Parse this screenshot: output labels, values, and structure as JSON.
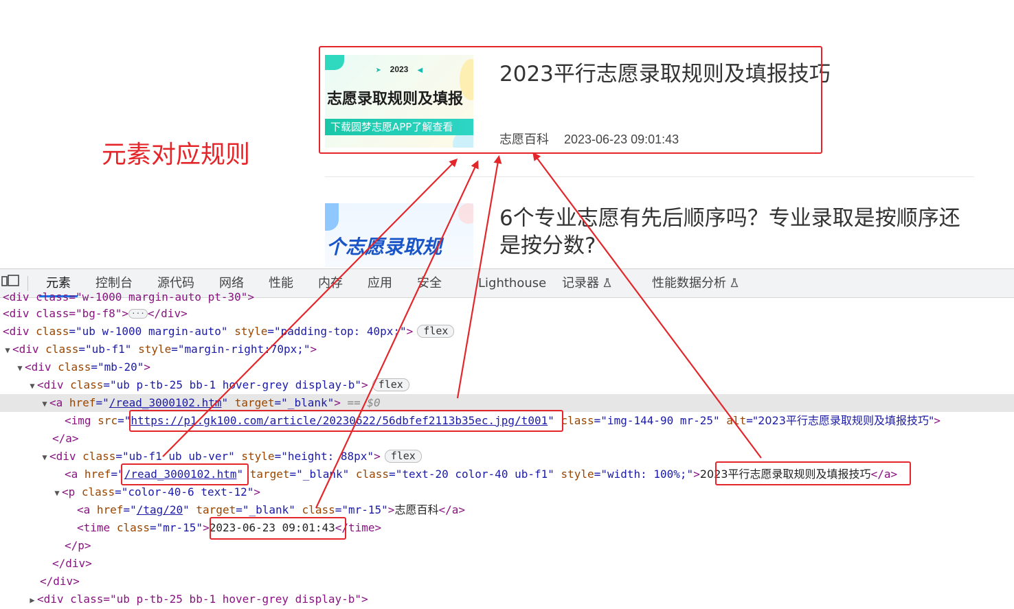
{
  "annotation": {
    "title": "元素对应规则"
  },
  "articles": [
    {
      "thumb_year": "2023",
      "thumb_title": "志愿录取规则及填报",
      "thumb_banner": "下载圆梦志愿APP了解查看",
      "title": "2023平行志愿录取规则及填报技巧",
      "tag": "志愿百科",
      "time": "2023-06-23 09:01:43"
    },
    {
      "thumb_title": "个志愿录取规",
      "title": "6个专业志愿有先后顺序吗？专业录取是按顺序还是按分数?"
    }
  ],
  "devtools": {
    "tabs": [
      "元素",
      "控制台",
      "源代码",
      "网络",
      "性能",
      "内存",
      "应用",
      "安全",
      "Lighthouse",
      "记录器",
      "性能数据分析"
    ],
    "lines": {
      "l0": "<div class=\"w-1000 margin-auto pt-30\">",
      "l1_open": "<div class=\"bg-f8\">",
      "l1_close": "</div>",
      "l2_tag": "<div",
      "l2_attr1": "class",
      "l2_val1": "\"ub w-1000 margin-auto\"",
      "l2_attr2": "style",
      "l2_val2": "\"padding-top: 40px;\"",
      "l2_end": ">",
      "flex": "flex",
      "l3_tag": "<div",
      "l3_attr1": "class",
      "l3_val1": "\"ub-f1\"",
      "l3_attr2": "style",
      "l3_val2": "\"margin-right:70px;\"",
      "l3_end": ">",
      "l4_tag": "<div",
      "l4_attr1": "class",
      "l4_val1": "\"mb-20\"",
      "l4_end": ">",
      "l5_tag": "<div",
      "l5_attr1": "class",
      "l5_val1": "\"ub p-tb-25 bb-1 hover-grey display-b\"",
      "l5_end": ">",
      "l6_tag": "<a",
      "l6_attr1": "href",
      "l6_link": "/read_3000102.htm",
      "l6_attr2": "target",
      "l6_val2": "\"_blank\"",
      "l6_end": ">",
      "l6_sel": "== $0",
      "l7_tag": "<img",
      "l7_attr1": "src",
      "l7_link": "https://p1.gk100.com/article/20230622/56dbfef2113b35ec.jpg/t001",
      "l7_attr2": "class",
      "l7_val2": "\"img-144-90 mr-25\"",
      "l7_attr3": "alt",
      "l7_val3": "\"2023平行志愿录取规则及填报技巧\"",
      "l7_end": ">",
      "l8": "</a>",
      "l9_tag": "<div",
      "l9_attr1": "class",
      "l9_val1": "\"ub-f1 ub ub-ver\"",
      "l9_attr2": "style",
      "l9_val2": "\"height: 88px\"",
      "l9_end": ">",
      "l10_tag": "<a",
      "l10_attr1": "href",
      "l10_link": "/read_3000102.htm",
      "l10_attr2": "target",
      "l10_val2": "\"_blank\"",
      "l10_attr3": "class",
      "l10_val3": "\"text-20 color-40 ub-f1\"",
      "l10_attr4": "style",
      "l10_val4": "\"width: 100%;\"",
      "l10_text": "2023平行志愿录取规则及填报技巧",
      "l10_close": "</a>",
      "l11_tag": "<p",
      "l11_attr1": "class",
      "l11_val1": "\"color-40-6 text-12\"",
      "l11_end": ">",
      "l12_tag": "<a",
      "l12_attr1": "href",
      "l12_link": "/tag/20",
      "l12_attr2": "target",
      "l12_val2": "\"_blank\"",
      "l12_attr3": "class",
      "l12_val3": "\"mr-15\"",
      "l12_text": "志愿百科",
      "l12_close": "</a>",
      "l13_tag": "<time",
      "l13_attr1": "class",
      "l13_val1": "\"mr-15\"",
      "l13_text": "2023-06-23 09:01:43",
      "l13_close": "</time>",
      "l14": "</p>",
      "l15": "</div>",
      "l16": "</div>",
      "l17": "<div class=\"ub p-tb-25 bb-1 hover-grey display-b\">"
    }
  },
  "colors": {
    "annotation_red": "#e4262a",
    "tag": "#881280",
    "attr_name": "#994500",
    "attr_value": "#1a1aa6",
    "active_tab": "#1a73e8"
  }
}
